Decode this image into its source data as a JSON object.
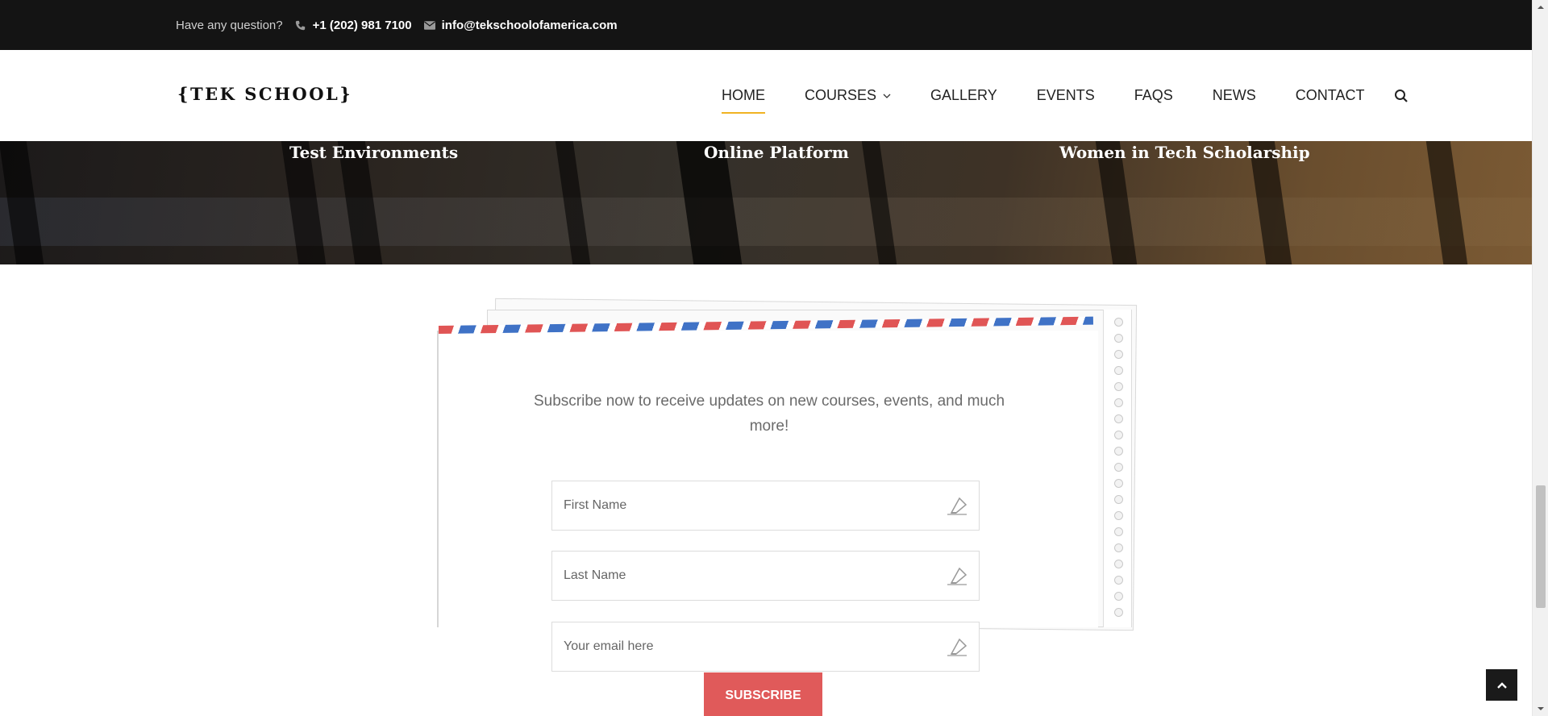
{
  "topbar": {
    "question": "Have any question?",
    "phone": "+1 (202) 981 7100",
    "email": "info@tekschoolofamerica.com",
    "icons": [
      "phone-icon",
      "envelope-icon"
    ]
  },
  "header": {
    "logo": "{TEK SCHOOL}",
    "nav": [
      "HOME",
      "COURSES",
      "GALLERY",
      "EVENTS",
      "FAQS",
      "NEWS",
      "CONTACT"
    ],
    "active": "HOME",
    "accent": "#f0b323"
  },
  "hero": {
    "features": [
      "Test Environments",
      "Online Platform",
      "Women in Tech Scholarship"
    ]
  },
  "subscribe": {
    "text": "Subscribe now to receive updates on new courses, events, and much more!",
    "fields": [
      {
        "placeholder": "First Name"
      },
      {
        "placeholder": "Last Name"
      },
      {
        "placeholder": "Your email here"
      }
    ],
    "button": "SUBSCRIBE",
    "button_color": "#e05a5a"
  }
}
